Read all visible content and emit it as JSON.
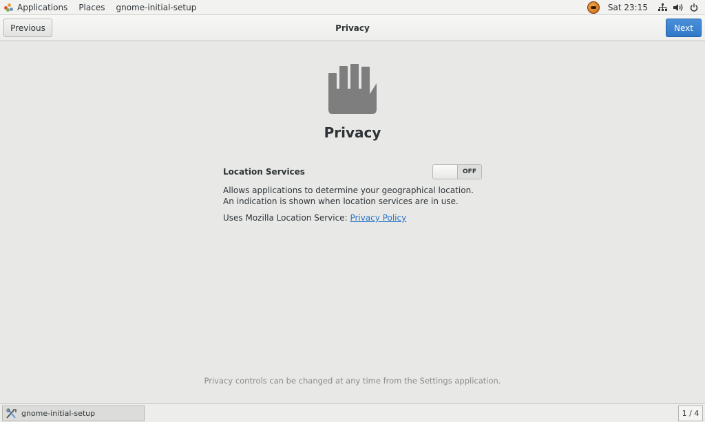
{
  "topbar": {
    "applications_label": "Applications",
    "places_label": "Places",
    "app_name": "gnome-initial-setup",
    "clock": "Sat 23:15",
    "icons": [
      "applications-icon",
      "hexchat-tray-icon",
      "network-icon",
      "volume-icon",
      "power-icon"
    ]
  },
  "header": {
    "previous_label": "Previous",
    "title": "Privacy",
    "next_label": "Next",
    "accent_color": "#3a84d5"
  },
  "page": {
    "icon": "hand-privacy-icon",
    "heading": "Privacy",
    "location_services": {
      "label": "Location Services",
      "toggle_state": "OFF",
      "description": "Allows applications to determine your geographical location. An indication is shown when location services are in use.",
      "uses_text": "Uses Mozilla Location Service:",
      "link_label": "Privacy Policy"
    },
    "footer_note": "Privacy controls can be changed at any time from the Settings application."
  },
  "taskbar": {
    "window_label": "gnome-initial-setup",
    "workspace": "1 / 4"
  }
}
